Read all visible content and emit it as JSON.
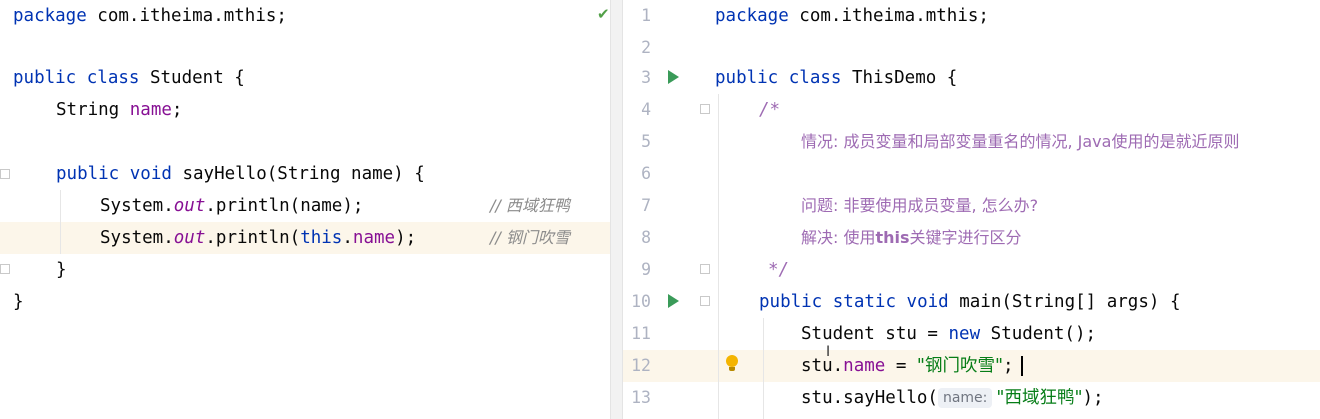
{
  "left_editor": {
    "lines": [
      {
        "package_kw": "package",
        "package_name": " com.itheima.mthis;"
      },
      {},
      {
        "kw1": "public",
        "kw2": "class",
        "rest": " Student {"
      },
      {
        "type": "String",
        "field": "name",
        "end": ";"
      },
      {},
      {
        "kw1": "public",
        "kw2": "void",
        "rest": " sayHello(String name) {"
      },
      {
        "a": "System.",
        "b": "out",
        "c": ".println(name);",
        "comment": "// 西域狂鸭"
      },
      {
        "a": "System.",
        "b": "out",
        "c": ".println(",
        "d": "this",
        "e": ".",
        "f": "name",
        "g": ");",
        "comment": "// 钢门吹雪"
      },
      {
        "brace": "}"
      },
      {
        "brace": "}"
      }
    ]
  },
  "right_editor": {
    "line_numbers": [
      "1",
      "2",
      "3",
      "4",
      "5",
      "6",
      "7",
      "8",
      "9",
      "10",
      "11",
      "12",
      "13"
    ],
    "lines": {
      "l1": {
        "kw": "package",
        "rest": " com.itheima.mthis;"
      },
      "l3": {
        "kw1": "public",
        "kw2": "class",
        "rest": " ThisDemo {"
      },
      "l4": {
        "text": "/*"
      },
      "l5": {
        "text": "情况: 成员变量和局部变量重名的情况, Java使用的是就近原则"
      },
      "l7": {
        "text": "问题: 非要使用成员变量, 怎么办?"
      },
      "l8": {
        "pre": "解决: 使用",
        "bold": "this",
        "post": "关键字进行区分"
      },
      "l9": {
        "text": "*/"
      },
      "l10": {
        "kw1": "public",
        "kw2": "static",
        "kw3": "void",
        "rest": " main(String[] args) {"
      },
      "l11": {
        "a": "Student stu = ",
        "kw": "new",
        "b": " Student();"
      },
      "l12": {
        "a": "stu.",
        "field": "name",
        "b": " = ",
        "str": "\"钢门吹雪\"",
        "c": ";"
      },
      "l13": {
        "a": "stu.sayHello(",
        "hint": "name:",
        "str": "\"西域狂鸭\"",
        "c": ");"
      }
    }
  },
  "colors": {
    "keyword": "#0033b3",
    "field": "#871094",
    "string": "#067d17",
    "comment": "#8c8c8c",
    "doc_comment": "#9e6bb3",
    "line_number": "#aeb3c2",
    "current_line": "#fcf6ea",
    "run_icon": "#3a9b59"
  },
  "icons": {
    "check": "check-icon",
    "run": "run-icon",
    "bulb": "lightbulb-icon",
    "fold": "fold-icon"
  }
}
